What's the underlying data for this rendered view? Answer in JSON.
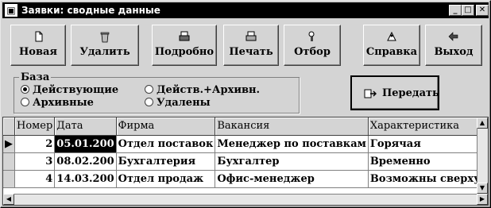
{
  "window": {
    "title": "Заявки: сводные данные",
    "controls": {
      "minimize": "_",
      "maximize": "□",
      "close": "✕"
    }
  },
  "toolbar": {
    "new_label": "Новая",
    "delete_label": "Удалить",
    "detail_label": "Подробно",
    "print_label": "Печать",
    "filter_label": "Отбор",
    "help_label": "Справка",
    "exit_label": "Выход",
    "transfer_label": "Передать"
  },
  "base_group": {
    "legend": "База",
    "options": [
      {
        "label": "Действующие",
        "checked": true
      },
      {
        "label": "Архивные",
        "checked": false
      },
      {
        "label": "Действ.+Архивн.",
        "checked": false
      },
      {
        "label": "Удалены",
        "checked": false
      }
    ]
  },
  "table": {
    "columns": [
      "Номер",
      "Дата",
      "Фирма",
      "Вакансия",
      "Характеристика"
    ],
    "rows": [
      {
        "number": "2",
        "date": "05.01.200",
        "firm": "Отдел поставок",
        "vacancy": "Менеджер по поставкам",
        "feature": "Горячая",
        "selected": true
      },
      {
        "number": "3",
        "date": "08.02.200",
        "firm": "Бухгалтерия",
        "vacancy": "Бухгалтер",
        "feature": "Временно",
        "selected": false
      },
      {
        "number": "4",
        "date": "14.03.200",
        "firm": "Отдел продаж",
        "vacancy": "Офис-менеджер",
        "feature": "Возможны сверхурочные",
        "selected": false
      }
    ]
  },
  "icons": {
    "new": "document-icon",
    "delete": "trash-icon",
    "detail": "printer-icon",
    "print": "printer-icon",
    "filter": "filter-icon",
    "help": "help-icon",
    "exit": "exit-icon",
    "transfer": "transfer-icon"
  }
}
